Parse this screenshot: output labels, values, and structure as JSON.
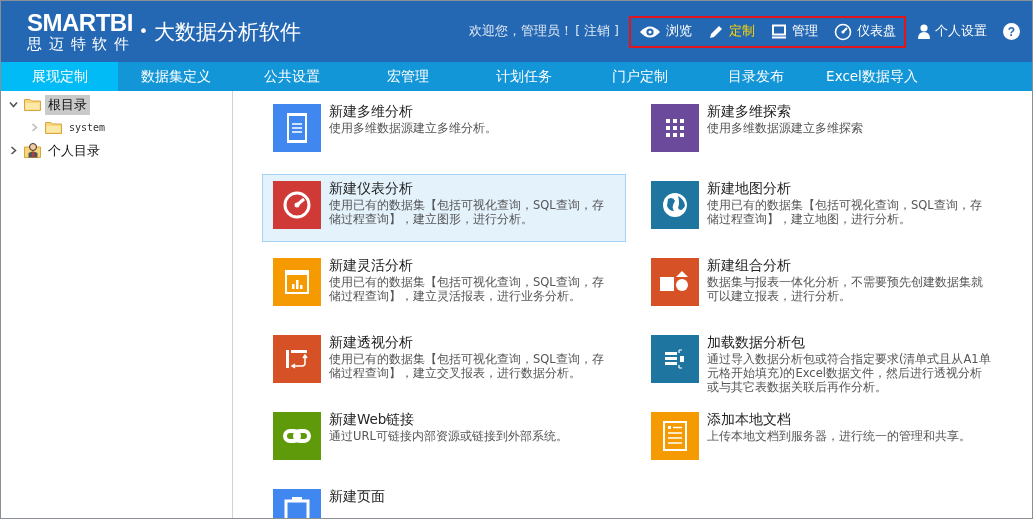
{
  "header": {
    "logo": "SMARTBI",
    "logo_subtitle": "思 迈 特 软 件",
    "tagline_dot": "•",
    "tagline": "大数据分析软件",
    "welcome": "欢迎您，管理员！",
    "logout": "[ 注销 ]",
    "modes": [
      {
        "label": "浏览",
        "kind": "eye",
        "selected": false
      },
      {
        "label": "定制",
        "kind": "pencil",
        "selected": true
      },
      {
        "label": "管理",
        "kind": "monitor",
        "selected": false
      },
      {
        "label": "仪表盘",
        "kind": "gauge",
        "selected": false
      }
    ],
    "settings": "个人设置",
    "help": "?"
  },
  "tabs": [
    {
      "label": "展现定制",
      "selected": true
    },
    {
      "label": "数据集定义",
      "selected": false
    },
    {
      "label": "公共设置",
      "selected": false
    },
    {
      "label": "宏管理",
      "selected": false
    },
    {
      "label": "计划任务",
      "selected": false
    },
    {
      "label": "门户定制",
      "selected": false
    },
    {
      "label": "目录发布",
      "selected": false
    },
    {
      "label": "Excel数据导入",
      "selected": false
    }
  ],
  "tree": [
    {
      "label": "根目录",
      "kind": "folder",
      "expanded": true,
      "selected": true,
      "children": [
        {
          "label": "system",
          "kind": "folder",
          "expanded": false,
          "selected": false
        }
      ]
    },
    {
      "label": "个人目录",
      "kind": "person",
      "expanded": false,
      "selected": false
    }
  ],
  "items": [
    {
      "title": "新建多维分析",
      "description": "使用多维数据源建立多维分析。",
      "kind": "document",
      "color": "#4088f0",
      "selected": false
    },
    {
      "title": "新建多维探索",
      "description": "使用多维数据源建立多维探索",
      "kind": "grid",
      "color": "#6b4a9c",
      "selected": false
    },
    {
      "title": "新建仪表分析",
      "description": "使用已有的数据集【包括可视化查询，SQL查询，存储过程查询】，建立图形，进行分析。",
      "kind": "gauge",
      "color": "#d03a36",
      "selected": true
    },
    {
      "title": "新建地图分析",
      "description": "使用已有的数据集【包括可视化查询，SQL查询，存储过程查询】，建立地图，进行分析。",
      "kind": "globe",
      "color": "#1e76a0",
      "selected": false
    },
    {
      "title": "新建灵活分析",
      "description": "使用已有的数据集【包括可视化查询，SQL查询，存储过程查询】，建立灵活报表，进行业务分析。",
      "kind": "chart",
      "color": "#f59a00",
      "selected": false
    },
    {
      "title": "新建组合分析",
      "description": "数据集与报表一体化分析，不需要预先创建数据集就可以建立报表，进行分析。",
      "kind": "shapes",
      "color": "#d65226",
      "selected": false
    },
    {
      "title": "新建透视分析",
      "description": "使用已有的数据集【包括可视化查询，SQL查询，存储过程查询】，建立交叉报表，进行数据分析。",
      "kind": "pivot",
      "color": "#d65226",
      "selected": false
    },
    {
      "title": "加载数据分析包",
      "description": "通过导入数据分析包或符合指定要求(清单式且从A1单元格开始填充)的Excel数据文件，然后进行透视分析或与其它表数据关联后再作分析。",
      "kind": "package",
      "color": "#1e76a0",
      "selected": false
    },
    {
      "title": "新建Web链接",
      "description": "通过URL可链接内部资源或链接到外部系统。",
      "kind": "link",
      "color": "#5e9a0a",
      "selected": false
    },
    {
      "title": "添加本地文档",
      "description": "上传本地文档到服务器，进行统一的管理和共享。",
      "kind": "textdoc",
      "color": "#f59a00",
      "selected": false
    },
    {
      "title": "新建页面",
      "kind": "page",
      "color": "#4088f0",
      "selected": false
    }
  ]
}
